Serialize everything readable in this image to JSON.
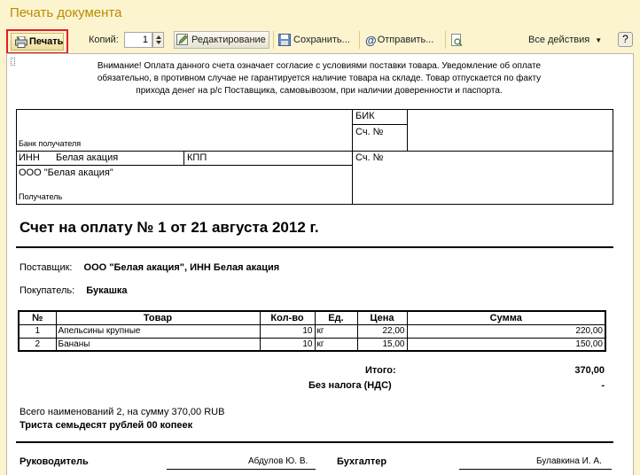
{
  "window": {
    "title": "Печать документа"
  },
  "toolbar": {
    "print_label": "Печать",
    "copies_label": "Копий:",
    "copies_value": "1",
    "edit_label": "Редактирование",
    "save_label": "Сохранить...",
    "send_label": "Отправить...",
    "all_actions_label": "Все действия",
    "help_label": "?"
  },
  "document": {
    "notice_line1": "Внимание! Оплата данного счета означает согласие с условиями поставки товара. Уведомление об оплате",
    "notice_line2": "обязательно, в противном случае не гарантируется наличие товара на складе. Товар отпускается по факту",
    "notice_line3": "прихода денег на р/с Поставщика, самовывозом, при наличии доверенности и паспорта.",
    "bank": {
      "bik_label": "БИК",
      "acc1_label": "Сч. №",
      "bank_label": "Банк получателя",
      "inn_label": "ИНН",
      "inn_value": "Белая акация",
      "kpp_label": "КПП",
      "acc2_label": "Сч. №",
      "recipient_name": "ООО \"Белая акация\"",
      "recipient_label": "Получатель"
    },
    "title": "Счет на оплату № 1 от 21 августа 2012 г.",
    "supplier_label": "Поставщик:",
    "supplier_value": "ООО \"Белая акация\", ИНН Белая акация",
    "buyer_label": "Покупатель:",
    "buyer_value": "Букашка",
    "table": {
      "headers": [
        "№",
        "Товар",
        "Кол-во",
        "Ед.",
        "Цена",
        "Сумма"
      ],
      "rows": [
        [
          "1",
          "Апельсины крупные",
          "10",
          "кг",
          "22,00",
          "220,00"
        ],
        [
          "2",
          "Бананы",
          "10",
          "кг",
          "15,00",
          "150,00"
        ]
      ]
    },
    "total_label": "Итого:",
    "total_value": "370,00",
    "vat_label": "Без налога (НДС)",
    "vat_value": "-",
    "summary_line": "Всего наименований 2, на сумму 370,00 RUB",
    "amount_words": "Триста семьдесят рублей 00 копеек",
    "director_label": "Руководитель",
    "director_name": "Абдулов Ю. В.",
    "accountant_label": "Бухгалтер",
    "accountant_name": "Булавкина И. А."
  },
  "colors": {
    "window_bg": "#fbf4cf",
    "title_color": "#b98c00",
    "highlight_frame": "#e31e24"
  }
}
